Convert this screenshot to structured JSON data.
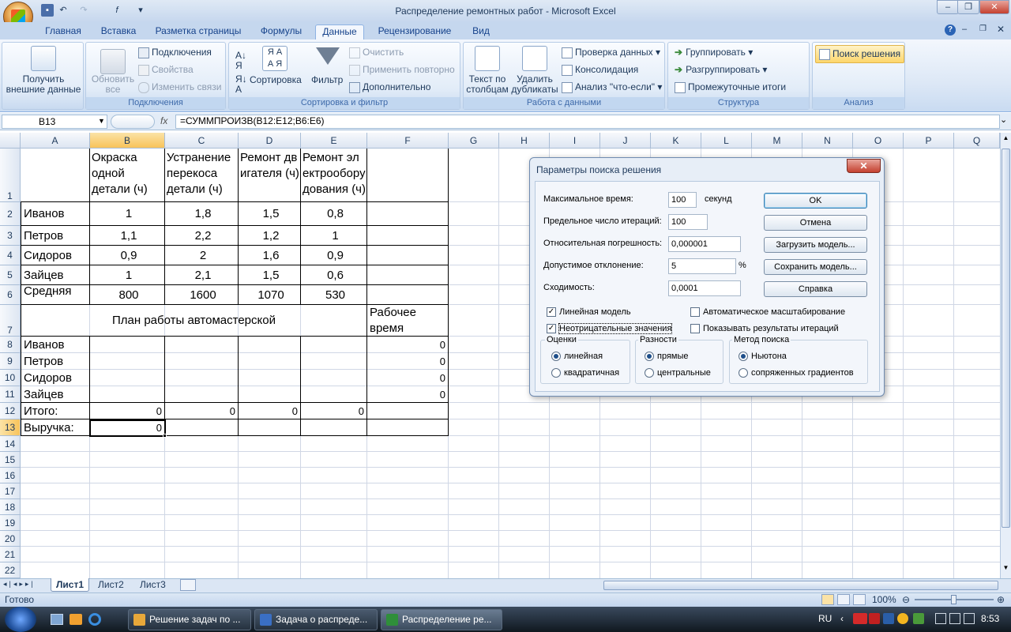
{
  "window": {
    "title": "Распределение ремонтных работ - Microsoft Excel"
  },
  "ribbon": {
    "tabs": [
      "Главная",
      "Вставка",
      "Разметка страницы",
      "Формулы",
      "Данные",
      "Рецензирование",
      "Вид"
    ],
    "active_tab": "Данные",
    "get_external": "Получить внешние данные",
    "refresh_all": "Обновить все",
    "connections": "Подключения",
    "properties": "Свойства",
    "edit_links": "Изменить связи",
    "group_connections": "Подключения",
    "sort": "Сортировка",
    "filter": "Фильтр",
    "clear": "Очистить",
    "reapply": "Применить повторно",
    "advanced": "Дополнительно",
    "group_sort_filter": "Сортировка и фильтр",
    "text_to_columns": "Текст по столбцам",
    "remove_duplicates": "Удалить дубликаты",
    "data_validation": "Проверка данных",
    "consolidate": "Консолидация",
    "what_if": "Анализ \"что-если\"",
    "group_data_tools": "Работа с данными",
    "group": "Группировать",
    "ungroup": "Разгруппировать",
    "subtotal": "Промежуточные итоги",
    "group_outline": "Структура",
    "solver": "Поиск решения",
    "group_analysis": "Анализ"
  },
  "formula_bar": {
    "name_box": "B13",
    "fx": "fx",
    "formula": "=СУММПРОИЗВ(B12:E12;B6:E6)"
  },
  "columns": [
    "A",
    "B",
    "C",
    "D",
    "E",
    "F",
    "G",
    "H",
    "I",
    "J",
    "K",
    "L",
    "M",
    "N",
    "O",
    "P",
    "Q"
  ],
  "rows": [
    "1",
    "2",
    "3",
    "4",
    "5",
    "6",
    "7",
    "8",
    "9",
    "10",
    "11",
    "12",
    "13",
    "14",
    "15",
    "16",
    "17",
    "18",
    "19",
    "20",
    "21",
    "22"
  ],
  "table": {
    "header": [
      "Окраска одной детали (ч)",
      "Устранение перекоса детали (ч)",
      "Ремонт двигателя (ч)",
      "Ремонт электрооборудования (ч)"
    ],
    "workers": [
      "Иванов",
      "Петров",
      "Сидоров",
      "Зайцев"
    ],
    "times": [
      [
        "1",
        "1,8",
        "1,5",
        "0,8"
      ],
      [
        "1,1",
        "2,2",
        "1,2",
        "1"
      ],
      [
        "0,9",
        "2",
        "1,6",
        "0,9"
      ],
      [
        "1",
        "2,1",
        "1,5",
        "0,6"
      ]
    ],
    "avg_label": "Средняя",
    "avg": [
      "800",
      "1600",
      "1070",
      "530"
    ],
    "plan_title": "План работы автомастерской",
    "work_time_label": "Рабочее время",
    "work_time": [
      "0",
      "0",
      "0",
      "0"
    ],
    "total_label": "Итого:",
    "totals": [
      "0",
      "0",
      "0",
      "0"
    ],
    "revenue_label": "Выручка:",
    "revenue": "0"
  },
  "sheets": [
    "Лист1",
    "Лист2",
    "Лист3"
  ],
  "status": {
    "ready": "Готово",
    "zoom": "100%"
  },
  "dialog": {
    "title": "Параметры поиска решения",
    "max_time_label": "Максимальное время:",
    "max_time": "100",
    "seconds": "секунд",
    "iterations_label": "Предельное число итераций:",
    "iterations": "100",
    "precision_label": "Относительная погрешность:",
    "precision": "0,000001",
    "tolerance_label": "Допустимое отклонение:",
    "tolerance": "5",
    "percent": "%",
    "convergence_label": "Сходимость:",
    "convergence": "0,0001",
    "ok": "OK",
    "cancel": "Отмена",
    "load_model": "Загрузить модель...",
    "save_model": "Сохранить модель...",
    "help": "Справка",
    "linear_model": "Линейная модель",
    "auto_scaling": "Автоматическое масштабирование",
    "non_negative": "Неотрицательные значения",
    "show_iterations": "Показывать результаты итераций",
    "estimates": "Оценки",
    "est_linear": "линейная",
    "est_quadratic": "квадратичная",
    "derivatives": "Разности",
    "der_forward": "прямые",
    "der_central": "центральные",
    "method": "Метод поиска",
    "method_newton": "Ньютона",
    "method_conjugate": "сопряженных градиентов"
  },
  "taskbar": {
    "tasks": [
      "Решение задач по ...",
      "Задача о распреде...",
      "Распределение ре..."
    ],
    "lang": "RU",
    "time": "8:53"
  }
}
